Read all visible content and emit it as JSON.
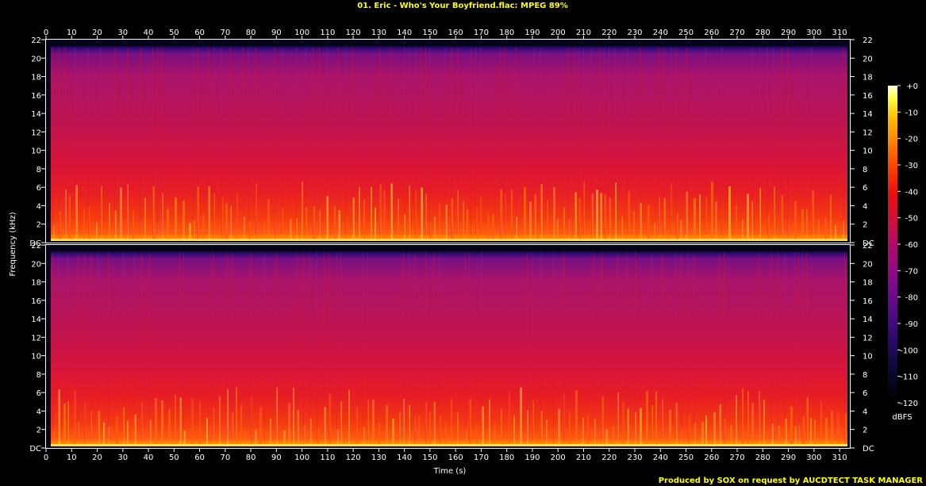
{
  "title": "01. Eric - Who's Your Boyfriend.flac: MPEG 89%",
  "footer": "Produced by SOX on request by AUCDTECT TASK MANAGER",
  "chart_data": {
    "type": "heatmap",
    "title": "01. Eric - Who's Your Boyfriend.flac: MPEG 89%",
    "xlabel": "Time (s)",
    "ylabel": "Frequency (kHz)",
    "x_ticks": [
      0,
      10,
      20,
      30,
      40,
      50,
      60,
      70,
      80,
      90,
      100,
      110,
      120,
      130,
      140,
      150,
      160,
      170,
      180,
      190,
      200,
      210,
      220,
      230,
      240,
      250,
      260,
      270,
      280,
      290,
      300,
      310
    ],
    "xlim": [
      0,
      314
    ],
    "ylim": [
      0,
      22
    ],
    "y_tick_labels": [
      "DC",
      "2",
      "4",
      "6",
      "8",
      "10",
      "12",
      "14",
      "16",
      "18",
      "20",
      "22"
    ],
    "y_tick_values": [
      0,
      2,
      4,
      6,
      8,
      10,
      12,
      14,
      16,
      18,
      20,
      22
    ],
    "channels": 2,
    "colorbar": {
      "label": "dBFS",
      "range": [
        -120,
        0
      ],
      "tick_labels": [
        "+0",
        "-10",
        "-20",
        "-30",
        "-40",
        "-50",
        "-60",
        "-70",
        "-80",
        "-90",
        "-100",
        "-110",
        "-120"
      ],
      "tick_values": [
        0,
        -10,
        -20,
        -30,
        -40,
        -50,
        -60,
        -70,
        -80,
        -90,
        -100,
        -110,
        -120
      ]
    },
    "colors": {
      "background": "#000000",
      "text_title": "#ffff00",
      "text_axis": "#ffffff",
      "colormap": [
        "#000000",
        "#0a0a30",
        "#2a0a6a",
        "#5a0a8a",
        "#8a0a8a",
        "#b00a6a",
        "#d0103a",
        "#e81010",
        "#ff4000",
        "#ff8000",
        "#ffc000",
        "#ffff40",
        "#ffffe0"
      ]
    }
  }
}
